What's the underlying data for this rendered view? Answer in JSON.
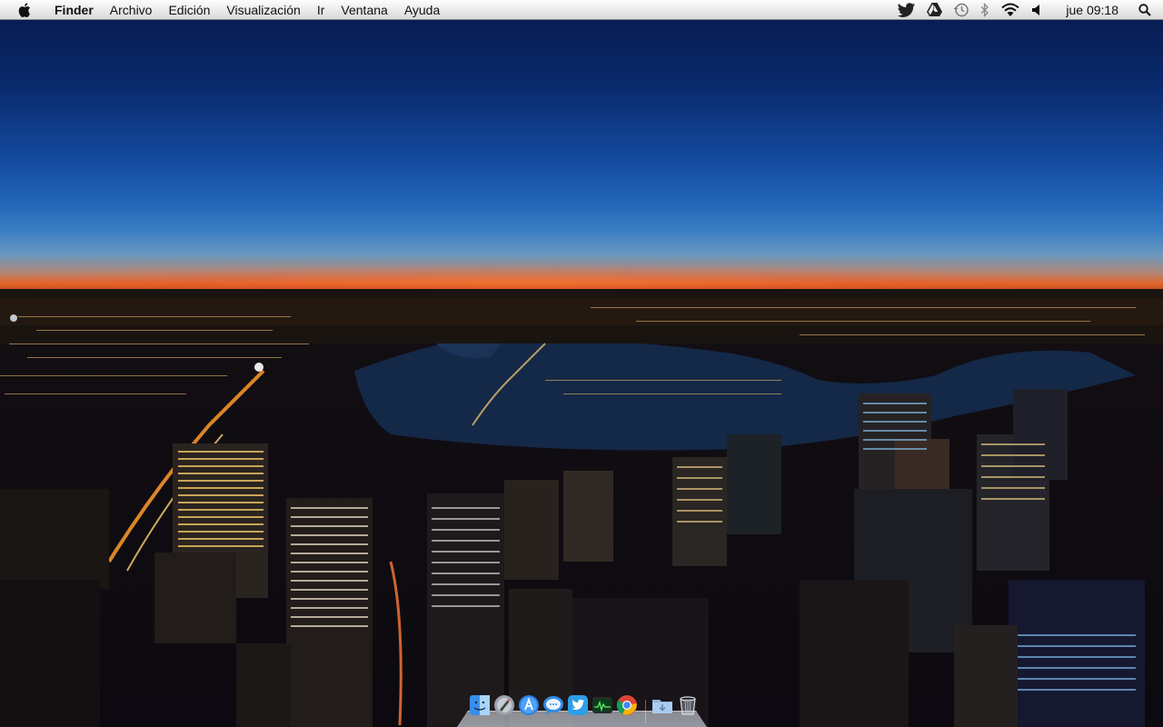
{
  "menubar": {
    "apple_icon": "apple-icon",
    "app_name": "Finder",
    "items": [
      "Archivo",
      "Edición",
      "Visualización",
      "Ir",
      "Ventana",
      "Ayuda"
    ],
    "status_icons": [
      "twitter-icon",
      "google-drive-icon",
      "time-machine-icon",
      "bluetooth-icon",
      "wifi-icon",
      "volume-icon"
    ],
    "clock": "jue 09:18",
    "spotlight_icon": "spotlight-search-icon"
  },
  "desktop": {
    "wallpaper": "night city skyline at dusk"
  },
  "dock": {
    "apps": [
      "finder-icon",
      "launchpad-icon",
      "app-store-icon",
      "messages-icon",
      "twitter-icon",
      "activity-monitor-icon",
      "chrome-icon"
    ],
    "stacks": [
      "downloads-folder-icon",
      "trash-icon"
    ]
  },
  "colors": {
    "sky_top": "#061a4a",
    "sky_mid": "#2266b8",
    "horizon": "#e0642a",
    "city_lights": "#ffb347"
  }
}
